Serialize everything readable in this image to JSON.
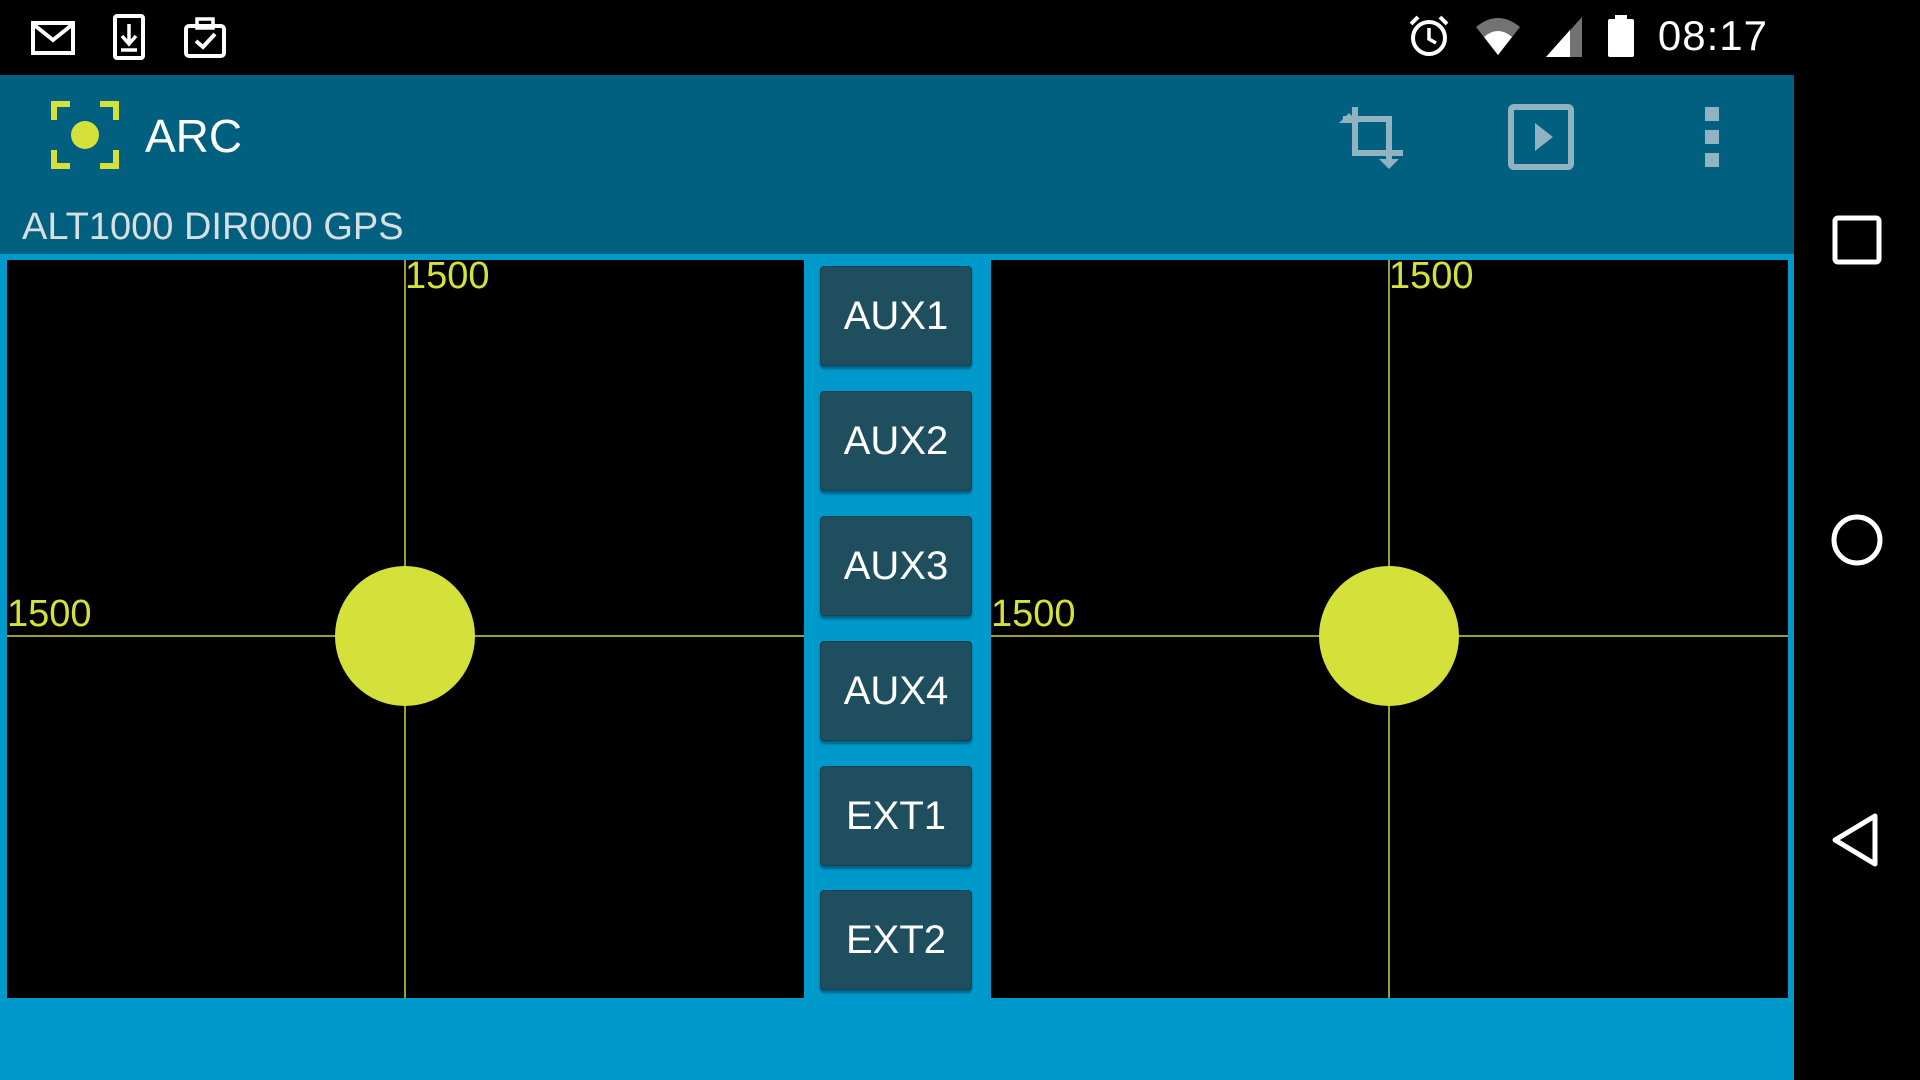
{
  "status_bar": {
    "time": "08:17",
    "left_icons": [
      "gmail-icon",
      "download-icon",
      "clipboard-check-icon"
    ],
    "right_icons": [
      "alarm-icon",
      "wifi-icon",
      "cell-signal-icon",
      "battery-icon"
    ]
  },
  "app_bar": {
    "title": "ARC",
    "logo_icon": "focus-target-icon",
    "actions": [
      "crop-icon",
      "play-icon",
      "overflow-menu-icon"
    ]
  },
  "telemetry": "ALT1000 DIR000 GPS",
  "sticks": {
    "left": {
      "x_value": "1500",
      "y_value": "1500"
    },
    "right": {
      "x_value": "1500",
      "y_value": "1500"
    }
  },
  "aux_buttons": [
    {
      "label": "AUX1"
    },
    {
      "label": "AUX2"
    },
    {
      "label": "AUX3"
    },
    {
      "label": "AUX4"
    },
    {
      "label": "EXT1"
    },
    {
      "label": "EXT2"
    }
  ],
  "colors": {
    "accent": "#d4e13a",
    "app_bar": "#01607f",
    "content_bg": "#0099cc",
    "button": "#1f4e5f"
  },
  "nav_bar": [
    "recents-icon",
    "home-icon",
    "back-icon"
  ]
}
